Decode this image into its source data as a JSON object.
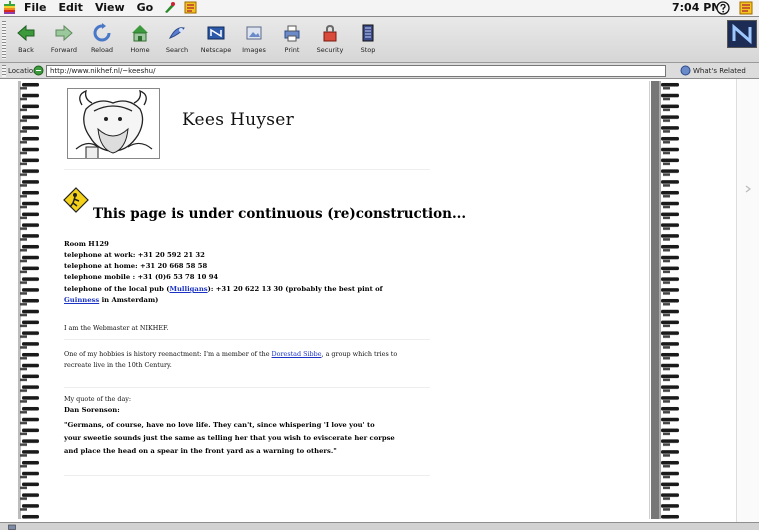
{
  "menubar": {
    "items": [
      "File",
      "Edit",
      "View",
      "Go"
    ],
    "clock": "7:04 PM"
  },
  "toolbar": {
    "buttons": [
      {
        "label": "Back",
        "icon": "back-arrow-icon"
      },
      {
        "label": "Forward",
        "icon": "forward-arrow-icon"
      },
      {
        "label": "Reload",
        "icon": "reload-icon"
      },
      {
        "label": "Home",
        "icon": "home-icon"
      },
      {
        "label": "Search",
        "icon": "search-icon"
      },
      {
        "label": "Netscape",
        "icon": "netscape-icon"
      },
      {
        "label": "Images",
        "icon": "images-icon"
      },
      {
        "label": "Print",
        "icon": "print-icon"
      },
      {
        "label": "Security",
        "icon": "security-icon"
      },
      {
        "label": "Stop",
        "icon": "stop-icon"
      }
    ]
  },
  "location": {
    "label": "Location:",
    "url": "http://www.nikhef.nl/~keeshu/",
    "related_label": "What's Related"
  },
  "page": {
    "owner_name": "Kees Huyser",
    "construction_heading": "This page is under continuous (re)construction...",
    "contact": {
      "room": "Room H129",
      "work": "telephone at work: +31 20 592 21 32",
      "home": "telephone at home: +31 20 668 58 58",
      "mobile": "telephone mobile : +31 (0)6 53 78 10 94",
      "pub_prefix": "telephone of the local pub (",
      "pub_link": "Mulligans",
      "pub_suffix": "): +31 20 622 13 30 (probably the best pint of",
      "guinness_link": "Guinness",
      "guinness_suffix": " in Amsterdam)"
    },
    "webmaster": "I am the Webmaster at NIKHEF.",
    "hobby_prefix": "One of my hobbies is history reenactment: I'm a member of the ",
    "hobby_link": "Dorestad Sibbe",
    "hobby_suffix": ", a group which tries to",
    "hobby_line2": "recreate live in the 10th Century.",
    "quote_intro": "My quote of the day:",
    "quote_author": "Dan Sorenson:",
    "quote_lines": [
      "\"Germans, of course, have no love life. They can't, since whispering 'I love you' to",
      "your sweetie sounds just the same as telling her that you wish to eviscerate her corpse",
      "and place the head on a spear in the front yard as a warning to others.\""
    ]
  },
  "colors": {
    "link": "#1a33c4",
    "netscape_accent": "#1c2c55"
  }
}
